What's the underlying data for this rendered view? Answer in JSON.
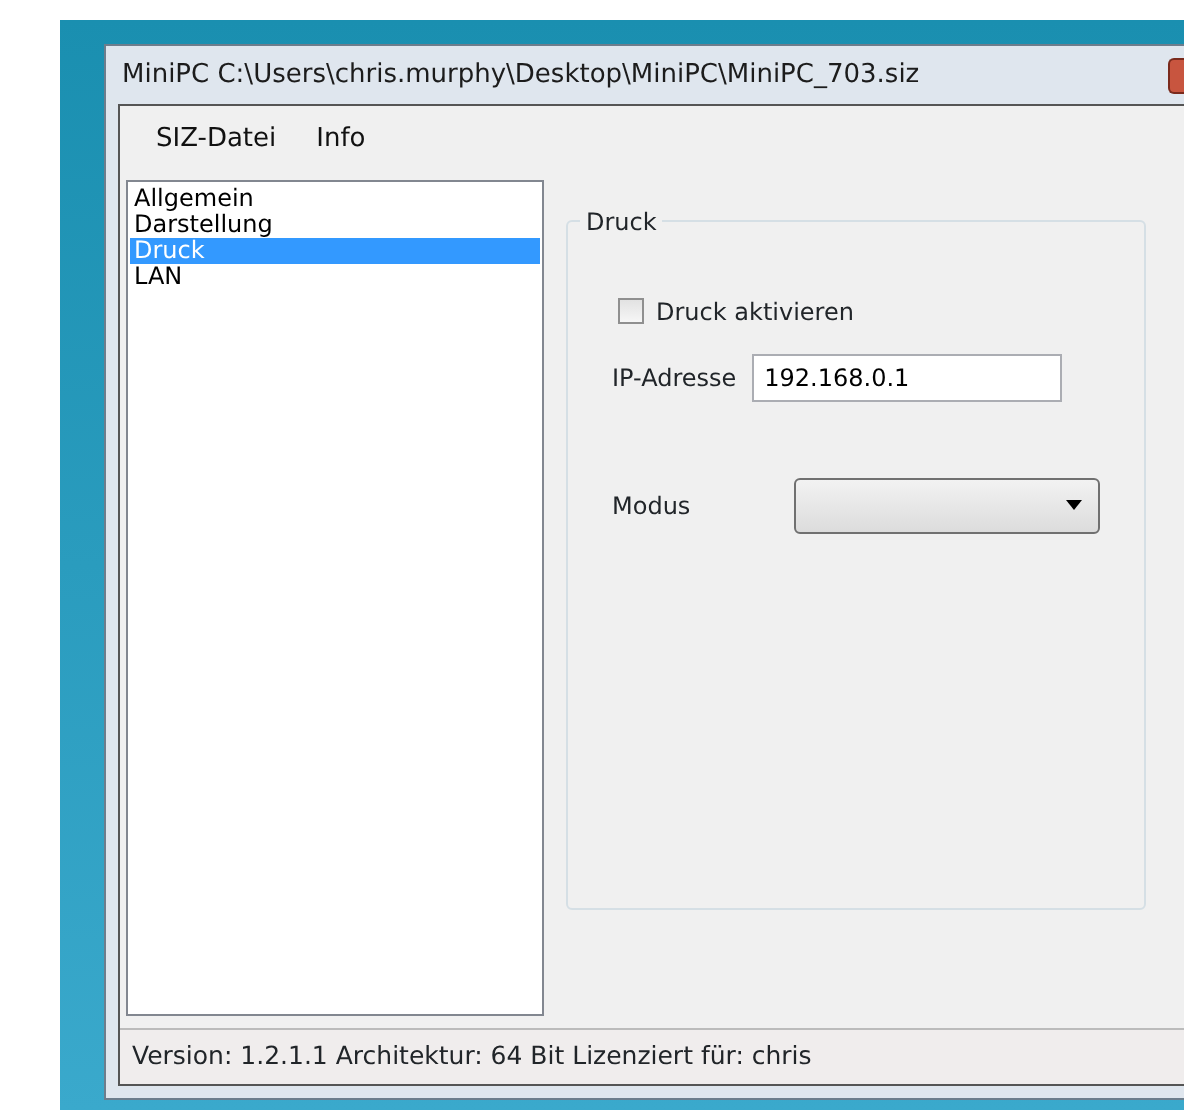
{
  "window": {
    "title": "MiniPC C:\\Users\\chris.murphy\\Desktop\\MiniPC\\MiniPC_703.siz"
  },
  "menu": [
    "SIZ-Datei",
    "Info"
  ],
  "sidebar": {
    "items": [
      {
        "label": "Allgemein",
        "selected": false
      },
      {
        "label": "Darstellung",
        "selected": false
      },
      {
        "label": "Druck",
        "selected": true
      },
      {
        "label": "LAN",
        "selected": false
      }
    ]
  },
  "group": {
    "title": "Druck",
    "checkbox": {
      "label": "Druck aktivieren",
      "checked": false
    },
    "ip": {
      "label": "IP-Adresse",
      "value": "192.168.0.1"
    },
    "mode": {
      "label": "Modus"
    }
  },
  "status_bar": "Version: 1.2.1.1 Architektur: 64 Bit Lizenziert für: chris"
}
